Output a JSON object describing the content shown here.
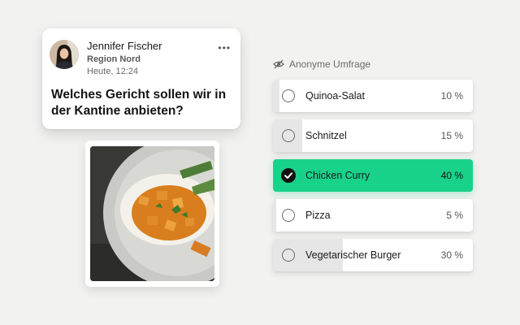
{
  "post": {
    "author": "Jennifer Fischer",
    "region": "Region Nord",
    "time": "Heute, 12:24",
    "question": "Welches Gericht sollen wir in der Kantine anbieten?",
    "more_icon": "more-horizontal-icon"
  },
  "poll": {
    "header_icon": "eye-off-icon",
    "header": "Anonyme Umfrage",
    "accent": "#19d28a",
    "options": [
      {
        "label": "Quinoa-Salat",
        "percent_text": "10 %",
        "percent": 10,
        "selected": false
      },
      {
        "label": "Schnitzel",
        "percent_text": "15 %",
        "percent": 15,
        "selected": false
      },
      {
        "label": "Chicken Curry",
        "percent_text": "40 %",
        "percent": 40,
        "selected": true
      },
      {
        "label": "Pizza",
        "percent_text": "5 %",
        "percent": 5,
        "selected": false
      },
      {
        "label": "Vegetarischer Burger",
        "percent_text": "30 %",
        "percent": 30,
        "selected": false
      }
    ]
  }
}
